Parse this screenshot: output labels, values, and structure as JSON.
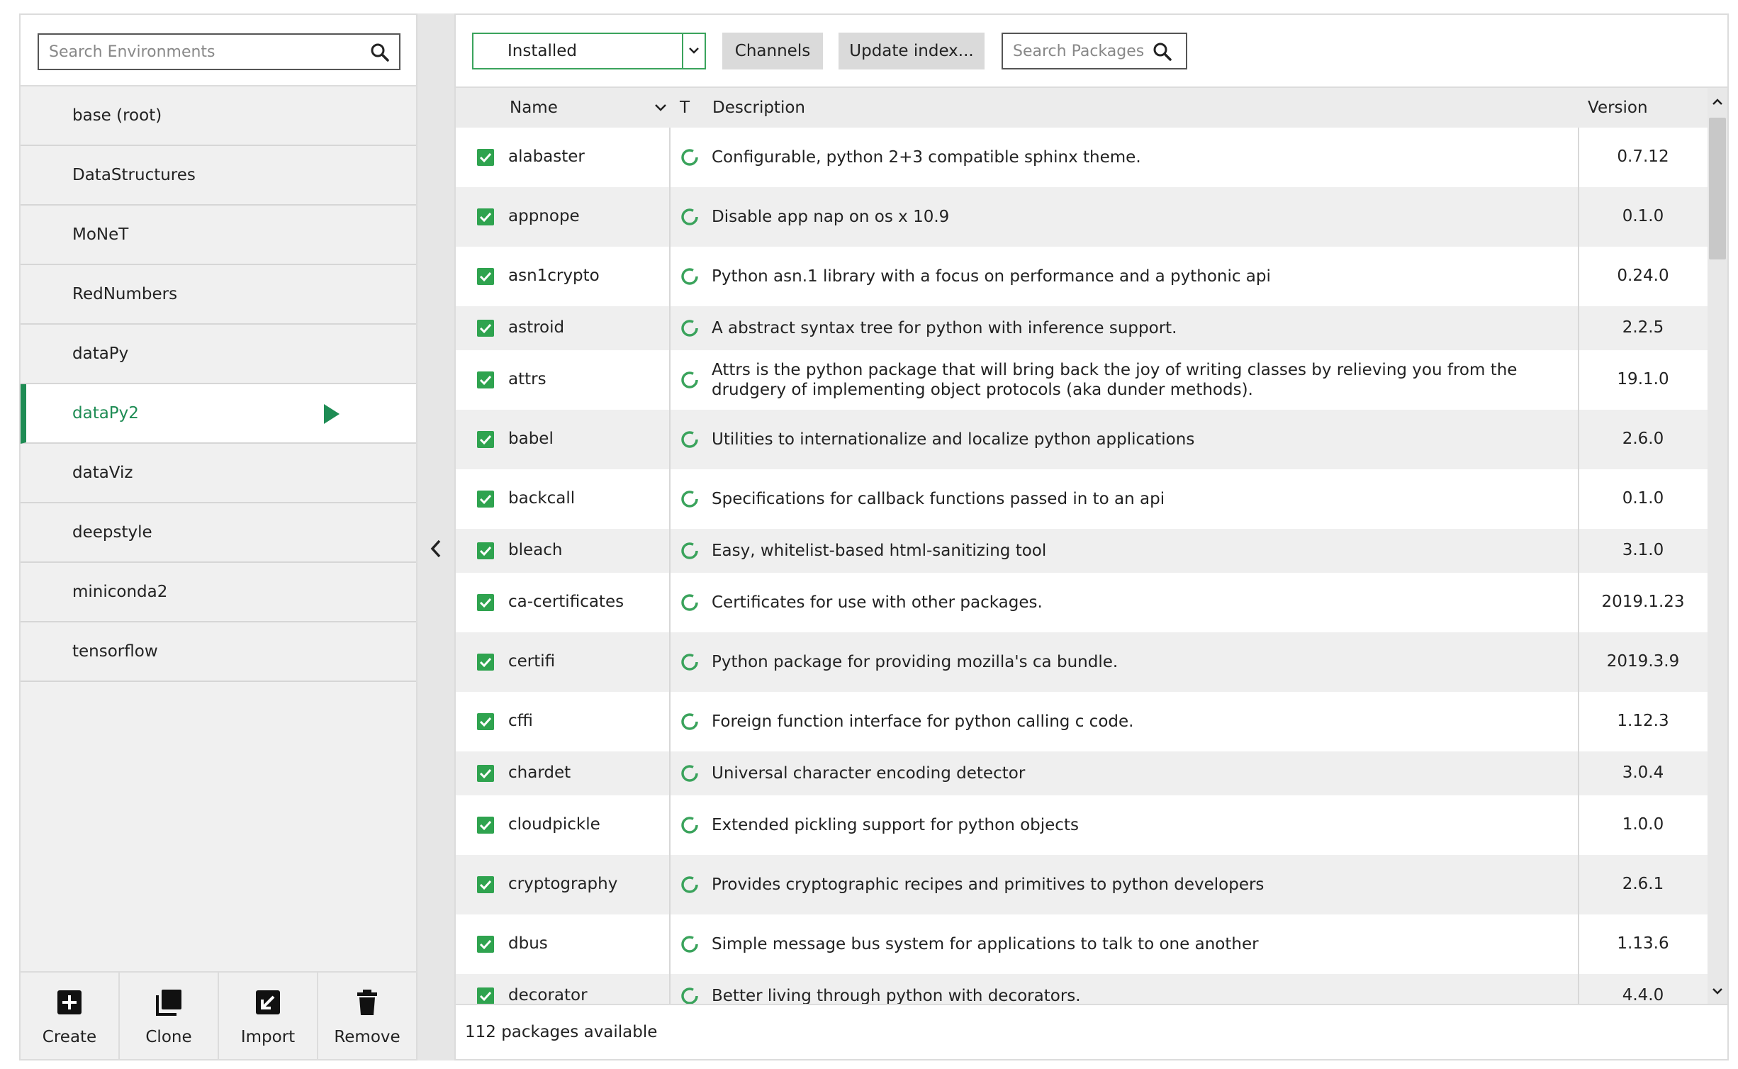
{
  "environments": {
    "search_placeholder": "Search Environments",
    "items": [
      {
        "label": "base (root)"
      },
      {
        "label": "DataStructures"
      },
      {
        "label": "MoNeT"
      },
      {
        "label": "RedNumbers"
      },
      {
        "label": "dataPy"
      },
      {
        "label": "dataPy2",
        "active": true
      },
      {
        "label": "dataViz"
      },
      {
        "label": "deepstyle"
      },
      {
        "label": "miniconda2"
      },
      {
        "label": "tensorflow"
      }
    ],
    "actions": {
      "create": "Create",
      "clone": "Clone",
      "import": "Import",
      "remove": "Remove"
    }
  },
  "toolbar": {
    "filter_value": "Installed",
    "channels_label": "Channels",
    "update_label": "Update index...",
    "search_placeholder": "Search Packages"
  },
  "table": {
    "headers": {
      "name": "Name",
      "type": "T",
      "description": "Description",
      "version": "Version"
    },
    "rows": [
      {
        "name": "alabaster",
        "description": "Configurable, python 2+3 compatible sphinx theme.",
        "version": "0.7.12"
      },
      {
        "name": "appnope",
        "description": "Disable app nap on os x 10.9",
        "version": "0.1.0"
      },
      {
        "name": "asn1crypto",
        "description": "Python asn.1 library with a focus on performance and a pythonic api",
        "version": "0.24.0"
      },
      {
        "name": "astroid",
        "description": "A abstract syntax tree for python with inference support.",
        "version": "2.2.5"
      },
      {
        "name": "attrs",
        "description": "Attrs is the python package that will bring back the joy of writing classes by relieving you from the drudgery of implementing object protocols (aka dunder methods).",
        "version": "19.1.0"
      },
      {
        "name": "babel",
        "description": "Utilities to internationalize and localize python applications",
        "version": "2.6.0"
      },
      {
        "name": "backcall",
        "description": "Specifications for callback functions passed in to an api",
        "version": "0.1.0"
      },
      {
        "name": "bleach",
        "description": "Easy, whitelist-based html-sanitizing tool",
        "version": "3.1.0"
      },
      {
        "name": "ca-certificates",
        "description": "Certificates for use with other packages.",
        "version": "2019.1.23"
      },
      {
        "name": "certifi",
        "description": "Python package for providing mozilla's ca bundle.",
        "version": "2019.3.9"
      },
      {
        "name": "cffi",
        "description": "Foreign function interface for python calling c code.",
        "version": "1.12.3"
      },
      {
        "name": "chardet",
        "description": "Universal character encoding detector",
        "version": "3.0.4"
      },
      {
        "name": "cloudpickle",
        "description": "Extended pickling support for python objects",
        "version": "1.0.0"
      },
      {
        "name": "cryptography",
        "description": "Provides cryptographic recipes and primitives to python developers",
        "version": "2.6.1"
      },
      {
        "name": "dbus",
        "description": "Simple message bus system for applications to talk to one another",
        "version": "1.13.6"
      },
      {
        "name": "decorator",
        "description": "Better living through python with decorators.",
        "version": "4.4.0"
      }
    ]
  },
  "status": {
    "text": "112 packages available"
  },
  "colors": {
    "accent_green": "#1e8c54",
    "checkbox_green": "#2fa34f"
  }
}
